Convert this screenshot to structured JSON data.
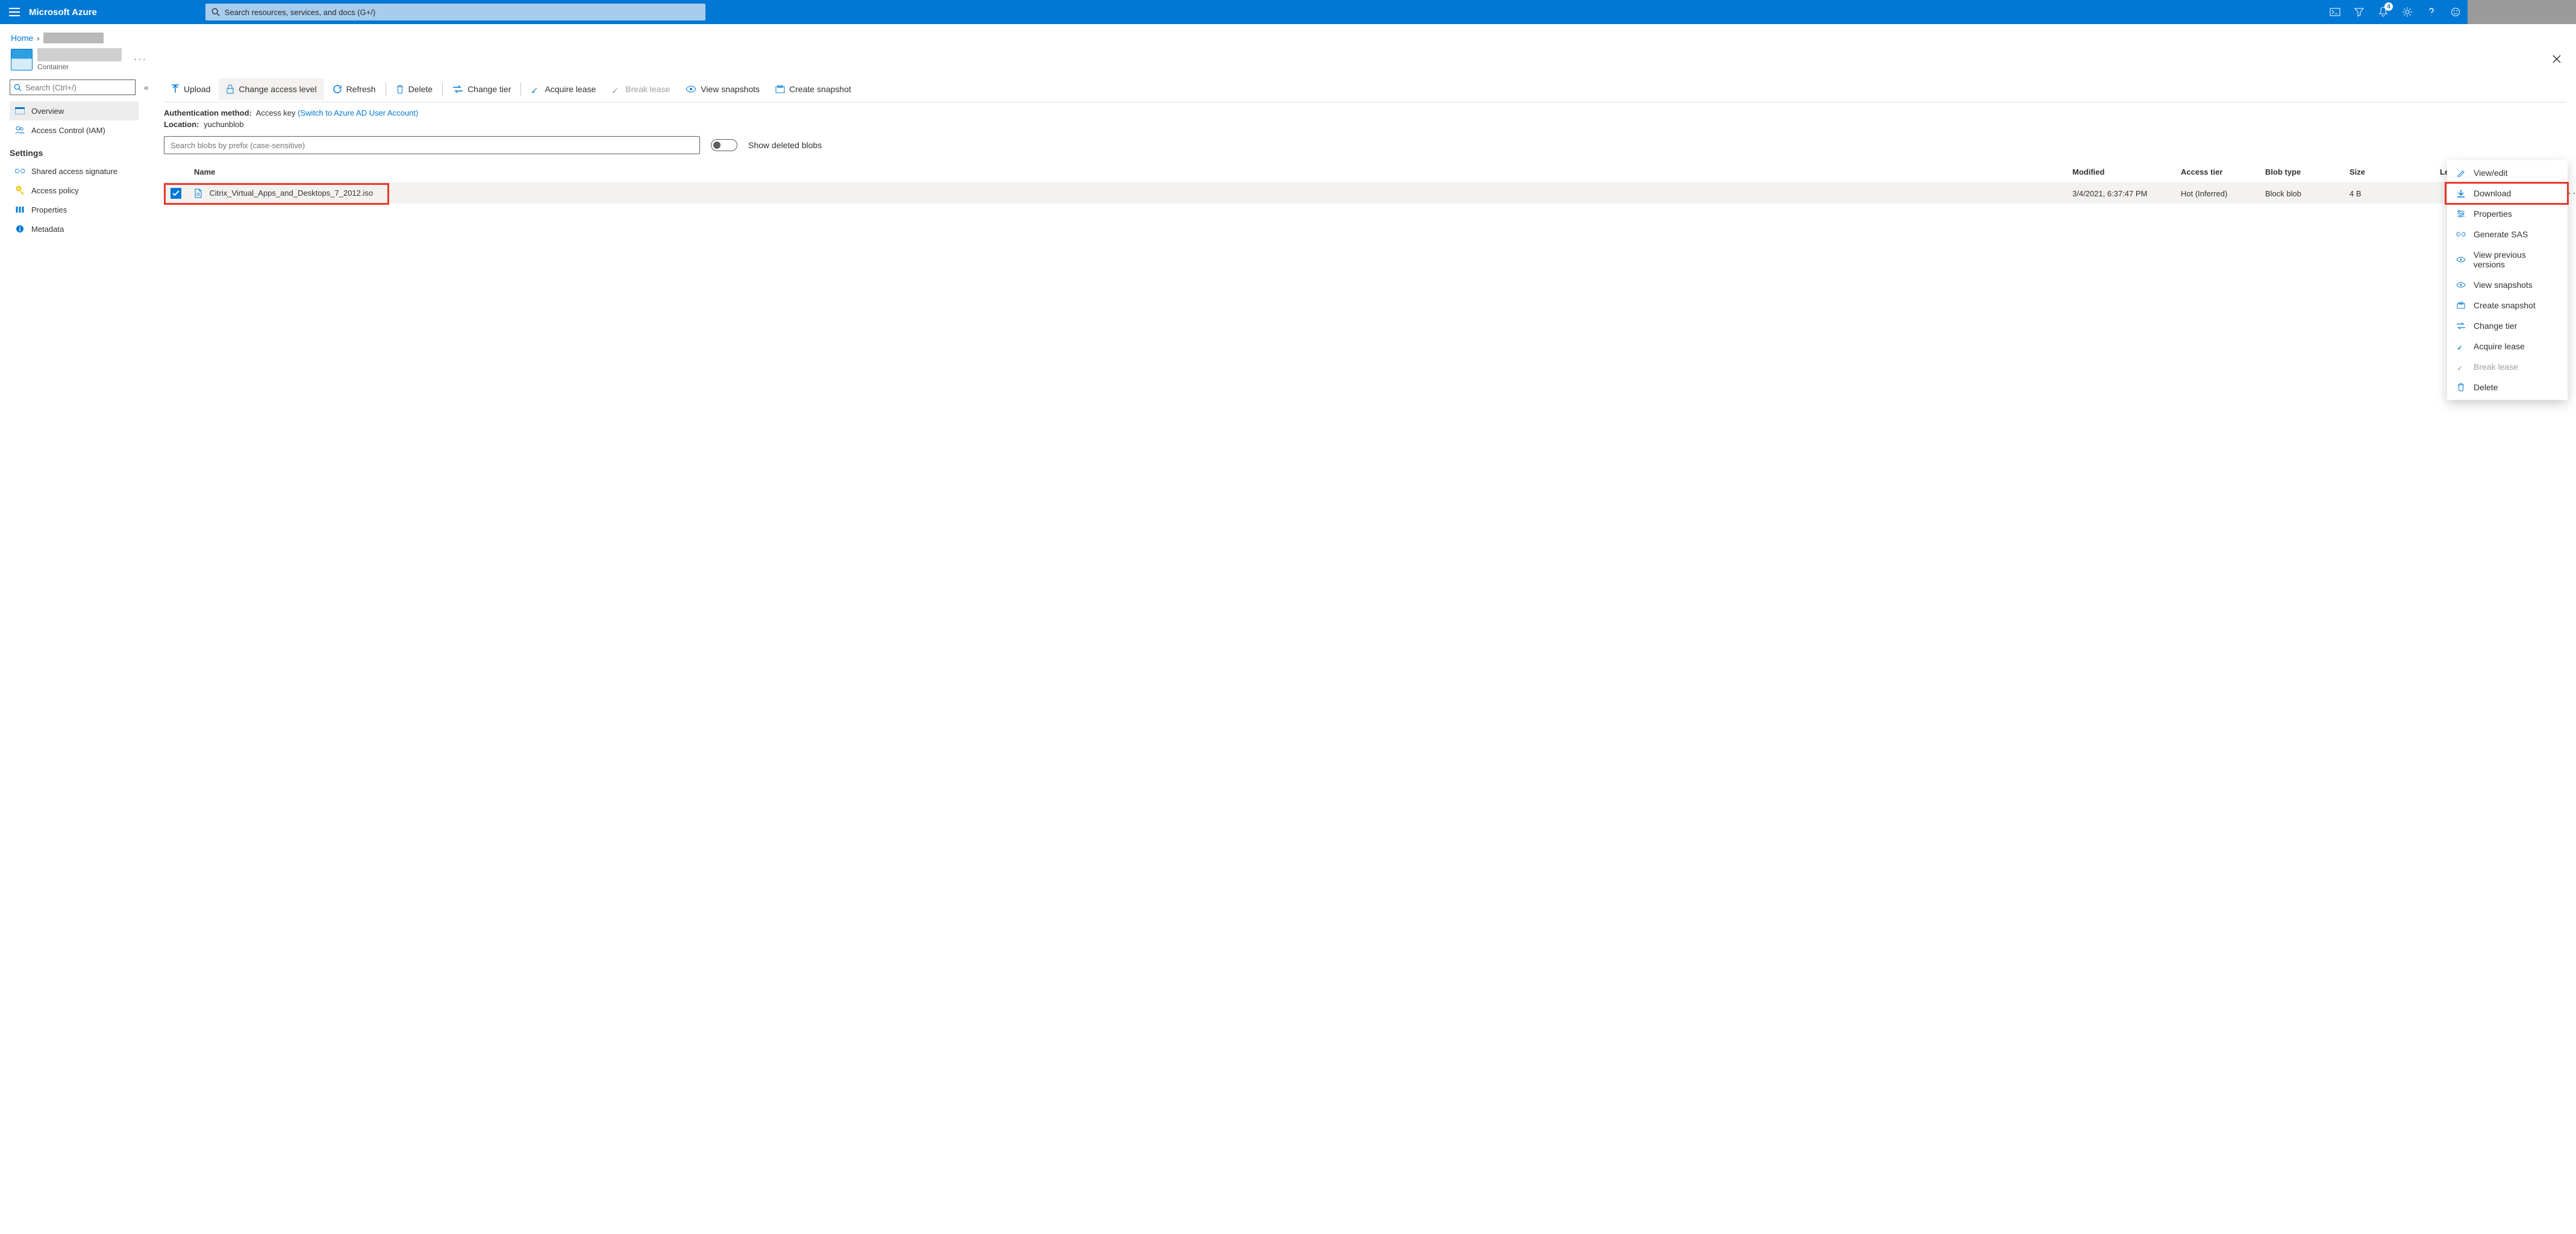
{
  "header": {
    "brand": "Microsoft Azure",
    "search_placeholder": "Search resources, services, and docs (G+/)",
    "notif_badge": "4"
  },
  "breadcrumb": {
    "home": "Home"
  },
  "page": {
    "subtitle": "Container"
  },
  "sidebar": {
    "search_placeholder": "Search (Ctrl+/)",
    "items": [
      {
        "label": "Overview"
      },
      {
        "label": "Access Control (IAM)"
      }
    ],
    "settings_heading": "Settings",
    "settings_items": [
      {
        "label": "Shared access signature"
      },
      {
        "label": "Access policy"
      },
      {
        "label": "Properties"
      },
      {
        "label": "Metadata"
      }
    ]
  },
  "toolbar": {
    "upload": "Upload",
    "change_access": "Change access level",
    "refresh": "Refresh",
    "delete": "Delete",
    "change_tier": "Change tier",
    "acquire_lease": "Acquire lease",
    "break_lease": "Break lease",
    "view_snapshots": "View snapshots",
    "create_snapshot": "Create snapshot"
  },
  "meta": {
    "auth_label": "Authentication method:",
    "auth_value": "Access key",
    "auth_link": "(Switch to Azure AD User Account)",
    "location_label": "Location:",
    "location_value": "yuchunblob"
  },
  "filter": {
    "blob_search_placeholder": "Search blobs by prefix (case-sensitive)",
    "toggle_label": "Show deleted blobs"
  },
  "table": {
    "columns": {
      "name": "Name",
      "modified": "Modified",
      "access_tier": "Access tier",
      "blob_type": "Blob type",
      "size": "Size",
      "lease_state": "Lease state"
    },
    "rows": [
      {
        "name": "Citrix_Virtual_Apps_and_Desktops_7_2012.iso",
        "modified": "3/4/2021, 6:37:47 PM",
        "access_tier": "Hot (Inferred)",
        "blob_type": "Block blob",
        "size": "4 B",
        "lease_state": ""
      }
    ]
  },
  "context_menu": {
    "items": [
      {
        "label": "View/edit",
        "icon": "pencil"
      },
      {
        "label": "Download",
        "icon": "download"
      },
      {
        "label": "Properties",
        "icon": "sliders"
      },
      {
        "label": "Generate SAS",
        "icon": "link"
      },
      {
        "label": "View previous versions",
        "icon": "eye"
      },
      {
        "label": "View snapshots",
        "icon": "eye"
      },
      {
        "label": "Create snapshot",
        "icon": "snapshot"
      },
      {
        "label": "Change tier",
        "icon": "swap"
      },
      {
        "label": "Acquire lease",
        "icon": "lease"
      },
      {
        "label": "Break lease",
        "icon": "break",
        "disabled": true
      },
      {
        "label": "Delete",
        "icon": "trash"
      }
    ]
  }
}
